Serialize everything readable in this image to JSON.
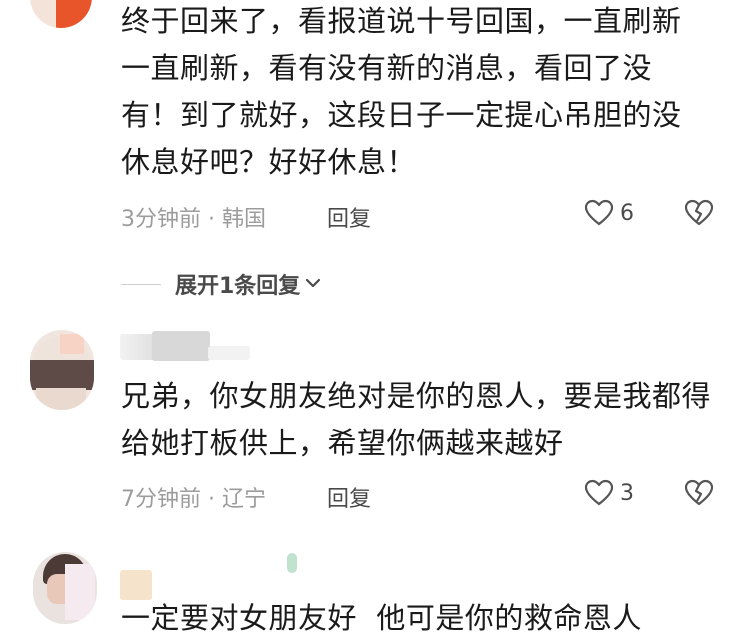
{
  "comments": [
    {
      "text": "终于回来了，看报道说十号回国，一直刷新一直刷新，看有没有新的消息，看回了没有！到了就好，这段日子一定提心吊胆的没休息好吧？好好休息！",
      "meta": "3分钟前 · 韩国",
      "reply_label": "回复",
      "likes": "6",
      "expand_label": "展开1条回复"
    },
    {
      "text": "兄弟，你女朋友绝对是你的恩人，要是我都得给她打板供上，希望你俩越来越好",
      "meta": "7分钟前 · 辽宁",
      "reply_label": "回复",
      "likes": "3"
    },
    {
      "text": "一定要对女朋友好  他可是你的救命恩人"
    }
  ],
  "icons": {
    "like": "heart-outline-icon",
    "dislike": "broken-heart-icon",
    "expand": "chevron-down-icon"
  },
  "colors": {
    "meta_gray": "#9c9c9c",
    "text": "#1a1a1a",
    "avatar_accent": "#e8552b"
  }
}
